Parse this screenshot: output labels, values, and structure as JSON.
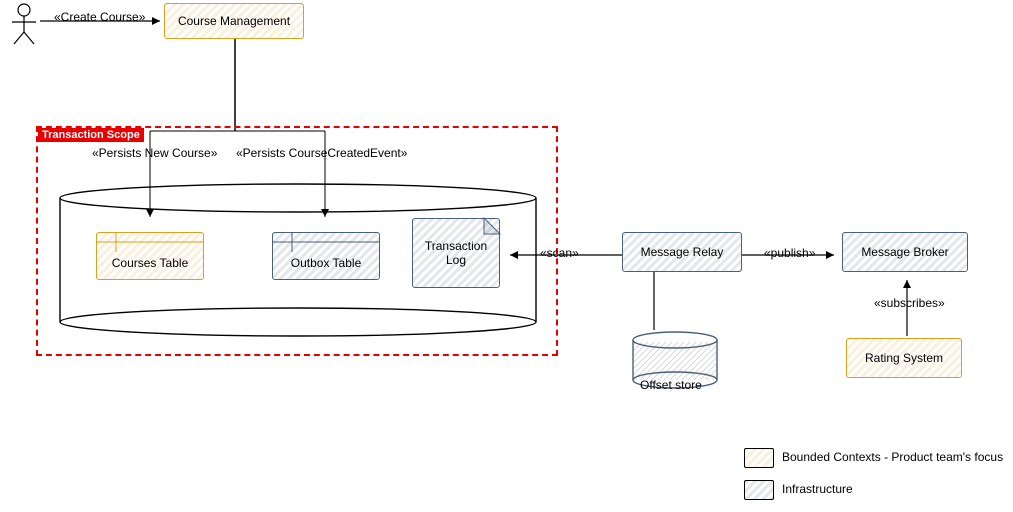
{
  "actor": {
    "action_label": "«Create Course»"
  },
  "nodes": {
    "course_management": "Course Management",
    "courses_table": "Courses Table",
    "outbox_table": "Outbox Table",
    "transaction_log": "Transaction\nLog",
    "message_relay": "Message Relay",
    "message_broker": "Message Broker",
    "offset_store": "Offset store",
    "rating_system": "Rating System"
  },
  "edges": {
    "persists_new_course": "«Persists New Course»",
    "persists_event": "«Persists CourseCreatedEvent»",
    "scan": "«scan»",
    "publish": "«publish»",
    "subscribes": "«subscribes»"
  },
  "scope_title": "Transaction Scope",
  "legend": {
    "bounded": "Bounded Contexts - Product team's focus",
    "infra": "Infrastructure"
  }
}
